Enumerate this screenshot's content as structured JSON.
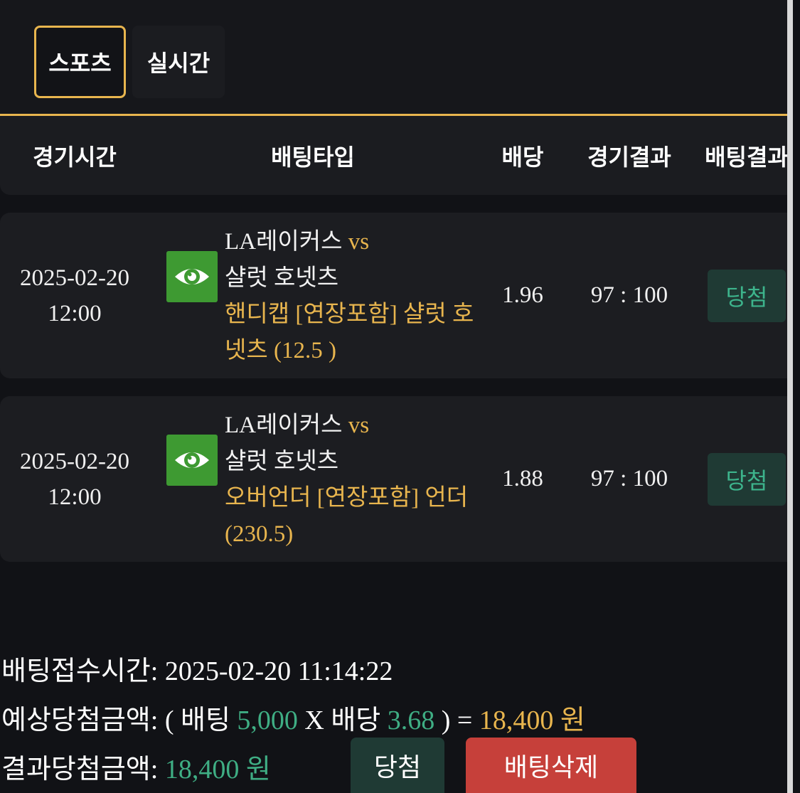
{
  "tabs": [
    {
      "label": "스포츠",
      "active": true
    },
    {
      "label": "실시간",
      "active": false
    }
  ],
  "columns": [
    "경기시간",
    "배팅타입",
    "배당",
    "경기결과",
    "배팅결과"
  ],
  "bets": [
    {
      "date": "2025-02-20",
      "time": "12:00",
      "teams": "LA레이커스",
      "vs": "vs",
      "opponent": "샬럿 호넷츠",
      "bet_type": "핸디캡 [연장포함] 샬럿 호넷츠 (12.5 )",
      "odds": "1.96",
      "score": "97 : 100",
      "result": "당첨"
    },
    {
      "date": "2025-02-20",
      "time": "12:00",
      "teams": "LA레이커스",
      "vs": "vs",
      "opponent": "샬럿 호넷츠",
      "bet_type": "오버언더 [연장포함] 언더 (230.5)",
      "odds": "1.88",
      "score": "97 : 100",
      "result": "당첨"
    }
  ],
  "summary": {
    "received_label": "배팅접수시간:",
    "received_value": "2025-02-20 11:14:22",
    "expected_label": "예상당첨금액:",
    "expected_open": "( 배팅",
    "stake": "5,000",
    "times": "X 배당",
    "total_odds": "3.68",
    "expected_close": ") =",
    "expected_amount": "18,400 원",
    "result_label": "결과당첨금액:",
    "result_amount": "18,400 원"
  },
  "actions": {
    "win_label": "당첨",
    "delete_label": "배팅삭제"
  },
  "icons": {
    "view": "eye-icon"
  },
  "colors": {
    "accent_gold": "#e8b54e",
    "win_green": "#3fae84",
    "delete_red": "#c6403a",
    "eye_green": "#3e9a32"
  }
}
